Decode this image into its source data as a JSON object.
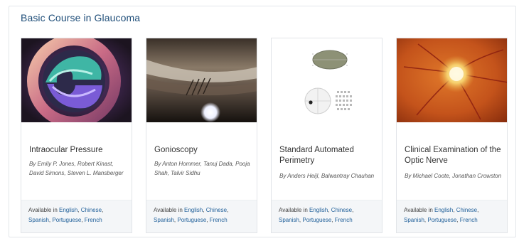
{
  "section": {
    "title": "Basic Course in Glaucoma"
  },
  "available_prefix": "Available in",
  "cards": [
    {
      "title": "Intraocular Pressure",
      "authors": "By Emily P. Jones, Robert Kinast, David Simons, Steven L. Mansberger",
      "languages": [
        "English",
        "Chinese",
        "Spanish",
        "Portuguese",
        "French"
      ],
      "image": "tonometry-photo"
    },
    {
      "title": "Gonioscopy",
      "authors": "By Anton Hommer, Tanuj Dada, Pooja Shah, Talvir Sidhu",
      "languages": [
        "English",
        "Chinese",
        "Spanish",
        "Portuguese",
        "French"
      ],
      "image": "gonioscopy-photo"
    },
    {
      "title": "Standard Automated Perimetry",
      "authors": "By Anders Heijl, Balwantray Chauhan",
      "languages": [
        "English",
        "Chinese",
        "Spanish",
        "Portuguese",
        "French"
      ],
      "image": "visual-field-printout"
    },
    {
      "title": "Clinical Examination of the Optic Nerve",
      "authors": "By Michael Coote, Jonathan Crowston",
      "languages": [
        "English",
        "Chinese",
        "Spanish",
        "Portuguese",
        "French"
      ],
      "image": "optic-disc-photo"
    }
  ]
}
